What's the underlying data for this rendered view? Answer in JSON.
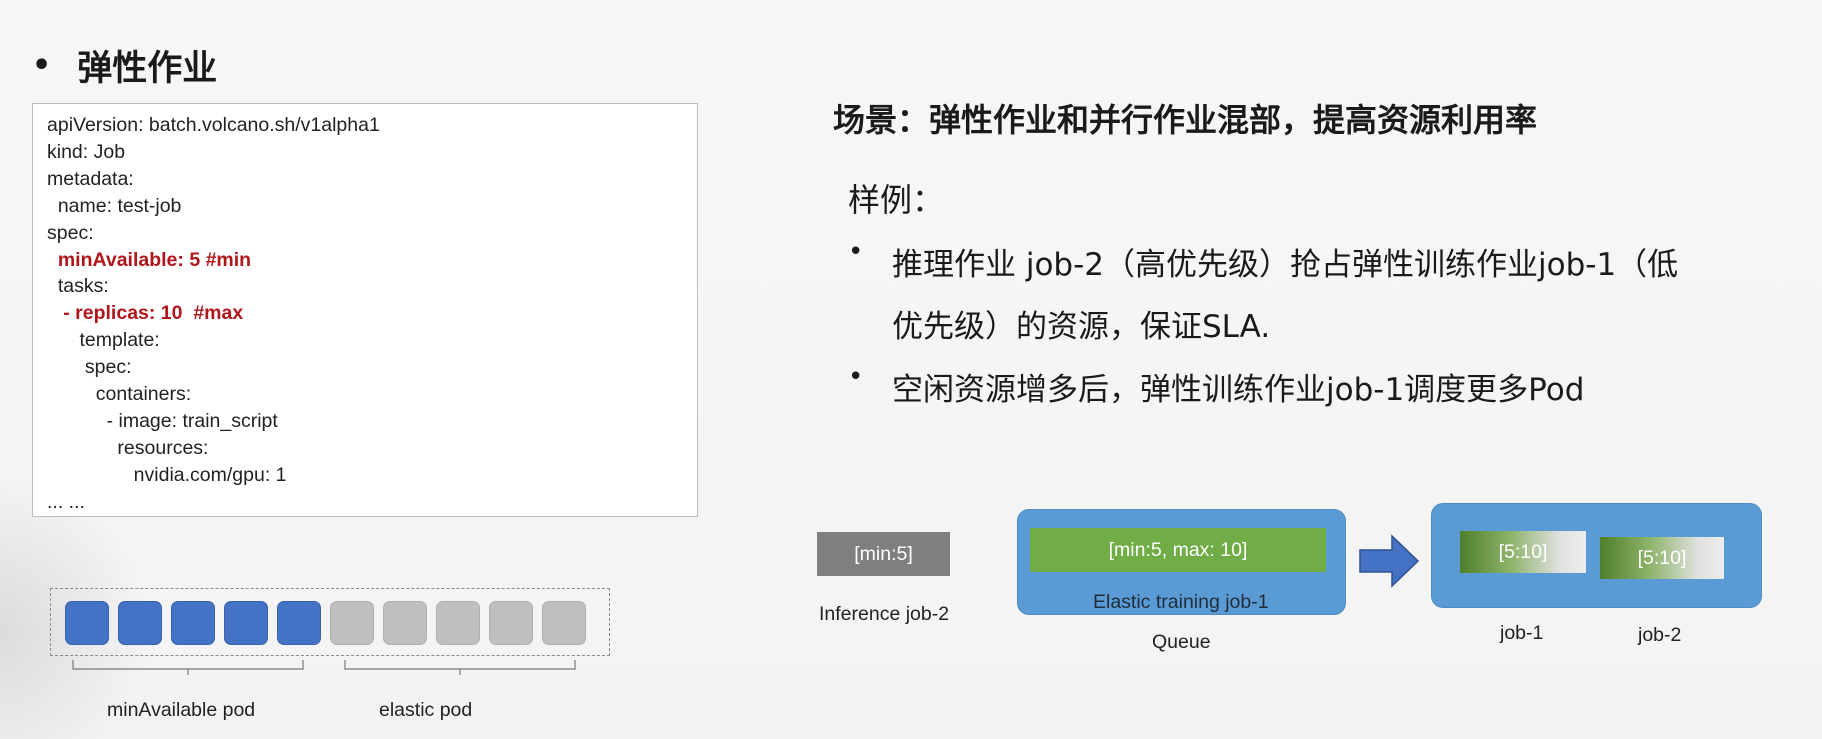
{
  "heading": {
    "bullet": "•",
    "title": "弹性作业"
  },
  "code_lines": [
    {
      "text": "apiVersion: batch.volcano.sh/v1alpha1",
      "hl": false
    },
    {
      "text": "kind: Job",
      "hl": false
    },
    {
      "text": "metadata:",
      "hl": false
    },
    {
      "text": "  name: test-job",
      "hl": false
    },
    {
      "text": "spec:",
      "hl": false
    },
    {
      "text": "  minAvailable: 5 #min",
      "hl": true
    },
    {
      "text": "  tasks:",
      "hl": false
    },
    {
      "text": "   - replicas: 10  #max",
      "hl": true
    },
    {
      "text": "      template:",
      "hl": false
    },
    {
      "text": "       spec:",
      "hl": false
    },
    {
      "text": "         containers:",
      "hl": false
    },
    {
      "text": "           - image: train_script",
      "hl": false
    },
    {
      "text": "             resources:",
      "hl": false
    },
    {
      "text": "                nvidia.com/gpu: 1",
      "hl": false
    },
    {
      "text": "... ...",
      "hl": false
    }
  ],
  "pods": {
    "min_count": 5,
    "elastic_count": 5,
    "min_label": "minAvailable pod",
    "elastic_label": "elastic pod"
  },
  "scenario": "场景：弹性作业和并行作业混部，提高资源利用率",
  "example_label": "样例：",
  "bullets": [
    {
      "mark": "•",
      "lines": [
        "推理作业 job-2（高优先级）抢占弹性训练作业job-1（低",
        "优先级）的资源，保证SLA."
      ]
    },
    {
      "mark": "•",
      "lines": [
        "空闲资源增多后，弹性训练作业job-1调度更多Pod"
      ]
    }
  ],
  "diagram": {
    "inference_box": "[min:5]",
    "inference_label": "Inference job-2",
    "queue_bar": "[min:5, max: 10]",
    "queue_inner_label": "Elastic training job-1",
    "queue_label": "Queue",
    "result_job1": "[5:10]",
    "result_job2": "[5:10]",
    "result_label1": "job-1",
    "result_label2": "job-2"
  },
  "colors": {
    "accent_blue": "#5b9bd5",
    "pod_blue": "#4472c4",
    "pod_gray": "#bfbfbf",
    "green": "#70ad47",
    "highlight_red": "#b0161a"
  }
}
